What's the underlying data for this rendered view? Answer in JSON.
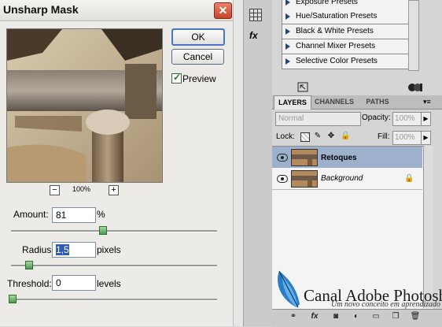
{
  "dialog": {
    "title": "Unsharp Mask",
    "close_glyph": "✕",
    "ok_label": "OK",
    "cancel_label": "Cancel",
    "preview_label": "Preview",
    "preview_checked": true,
    "zoom_out_glyph": "−",
    "zoom_in_glyph": "+",
    "zoom_level": "100%",
    "amount": {
      "label": "Amount:",
      "value": "81",
      "unit": "%"
    },
    "radius": {
      "label": "Radius:",
      "value": "1,5",
      "unit": "pixels"
    },
    "threshold": {
      "label": "Threshold:",
      "value": "0",
      "unit": "levels"
    }
  },
  "toolstrip": {
    "fx_glyph": "fx"
  },
  "adjustments": {
    "presets": [
      "Exposure Presets",
      "Hue/Saturation Presets",
      "Black & White Presets",
      "Channel Mixer Presets",
      "Selective Color Presets"
    ]
  },
  "layers_panel": {
    "tabs": [
      "LAYERS",
      "CHANNELS",
      "PATHS"
    ],
    "menu_glyph": "▾≡",
    "blend_mode": "Normal",
    "opacity_label": "Opacity:",
    "opacity_value": "100%",
    "lock_label": "Lock:",
    "fill_label": "Fill:",
    "fill_value": "100%",
    "arrow_glyph": "▶",
    "layers": [
      {
        "name": "Retoques",
        "selected": true
      },
      {
        "name": "Background",
        "locked": true
      }
    ],
    "lock_glyph": "🔒"
  },
  "brand": {
    "title": "Canal Adobe Photoshop",
    "tagline": "Um novo conceito em aprendizado"
  },
  "colors": {
    "selected_layer": "#9db0cc",
    "close_button": "#c8442a",
    "slider_thumb": "#4d9a4d"
  }
}
